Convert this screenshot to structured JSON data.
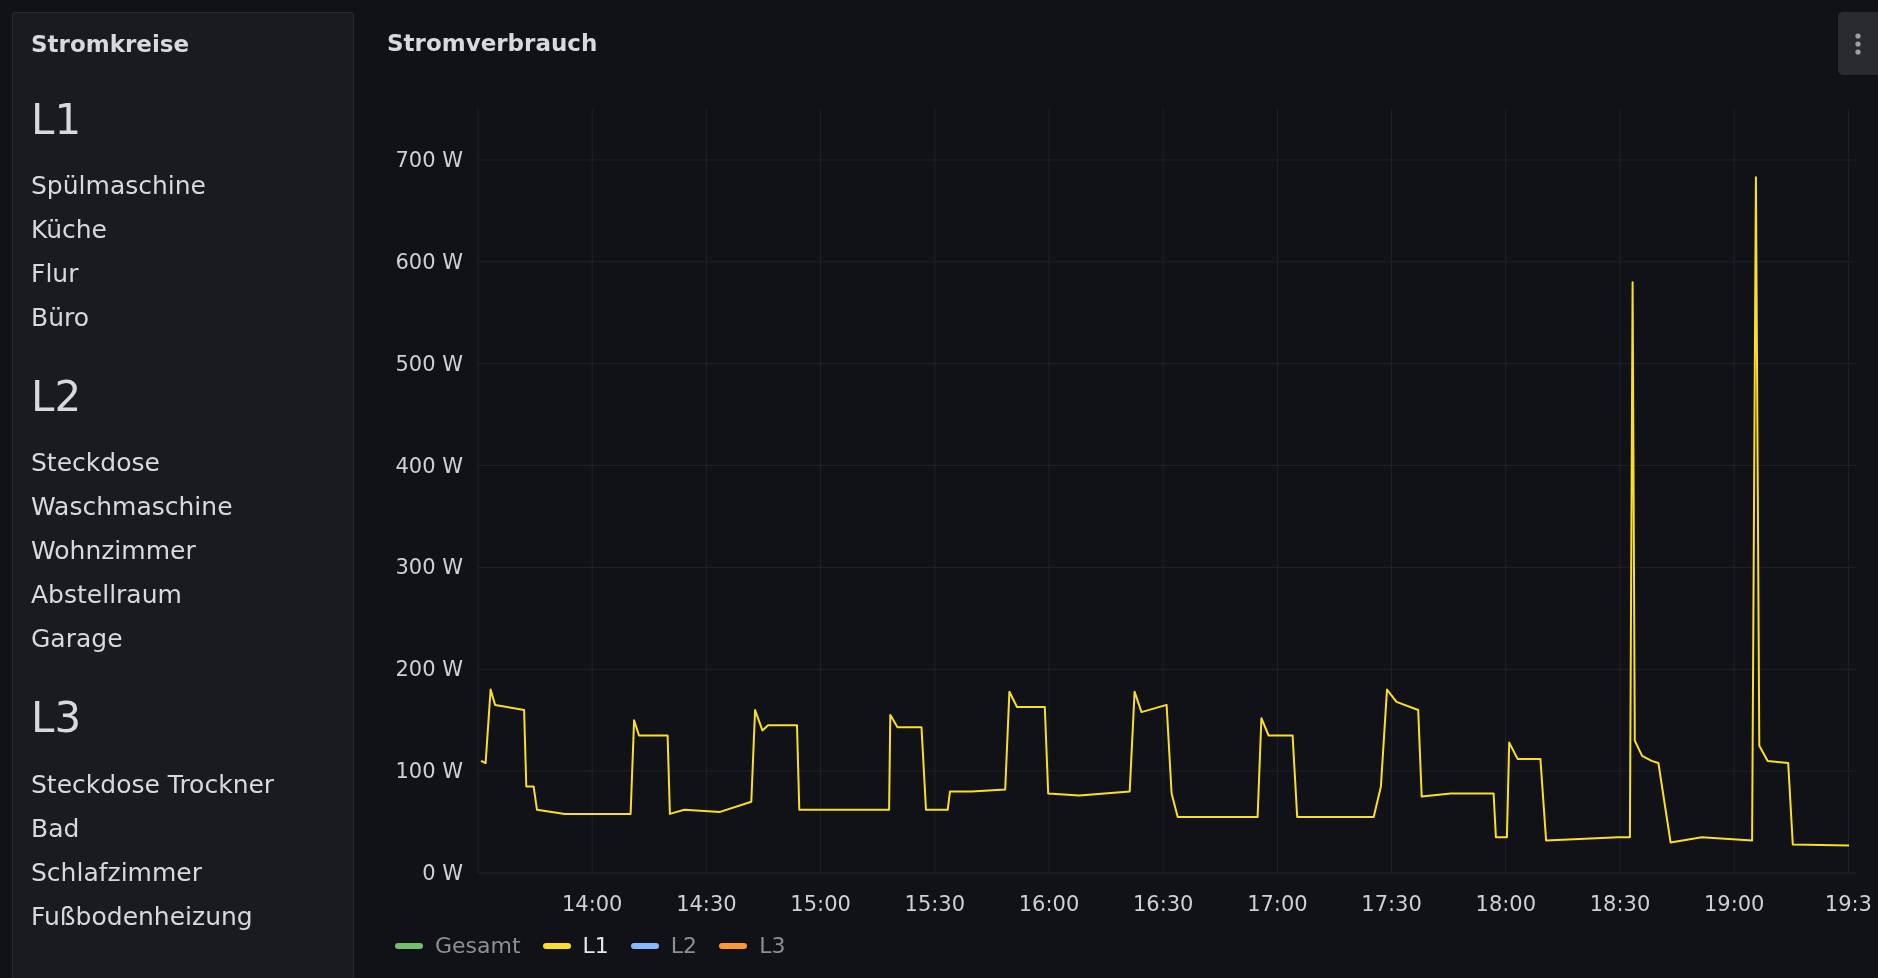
{
  "circuits_panel": {
    "title": "Stromkreise",
    "sections": [
      {
        "heading": "L1",
        "items": [
          "Spülmaschine",
          "Küche",
          "Flur",
          "Büro"
        ]
      },
      {
        "heading": "L2",
        "items": [
          "Steckdose",
          "Waschmaschine",
          "Wohnzimmer",
          "Abstellraum",
          "Garage"
        ]
      },
      {
        "heading": "L3",
        "items": [
          "Steckdose Trockner",
          "Bad",
          "Schlafzimmer",
          "Fußbodenheizung"
        ]
      }
    ]
  },
  "consumption_panel": {
    "title": "Stromverbrauch",
    "chart_data": {
      "type": "line",
      "grid": true,
      "x": [
        810.8,
        812.0,
        813.3,
        814.5,
        822.1,
        822.7,
        824.6,
        825.5,
        832.8,
        841.3,
        850.1,
        851.0,
        852.3,
        859.8,
        860.4,
        864.2,
        873.6,
        881.8,
        882.8,
        884.7,
        886.2,
        893.8,
        894.4,
        905.1,
        918.0,
        918.3,
        920.2,
        926.5,
        927.7,
        933.4,
        934.0,
        939.7,
        948.5,
        949.6,
        951.6,
        958.9,
        959.8,
        968.0,
        981.2,
        982.5,
        984.3,
        990.9,
        992.2,
        993.8,
        999.4,
        1014.8,
        1015.8,
        1017.7,
        1024.0,
        1025.2,
        1045.3,
        1047.2,
        1048.8,
        1051.3,
        1057.0,
        1057.9,
        1065.5,
        1076.8,
        1077.4,
        1080.3,
        1080.9,
        1083.1,
        1089.1,
        1090.6,
        1109.5,
        1112.6,
        1113.3,
        1113.9,
        1115.8,
        1118.3,
        1120.1,
        1123.3,
        1131.5,
        1144.7,
        1145.7,
        1146.6,
        1148.8,
        1154.2,
        1155.4,
        1170.2
      ],
      "series": [
        {
          "name": "L1",
          "color": "#fade2a",
          "values": [
            110,
            108,
            180,
            165,
            160,
            85,
            85,
            62,
            58,
            58,
            58,
            150,
            135,
            135,
            58,
            62,
            60,
            70,
            160,
            140,
            145,
            145,
            62,
            62,
            62,
            155,
            143,
            143,
            62,
            62,
            80,
            80,
            82,
            178,
            163,
            163,
            78,
            76,
            80,
            178,
            158,
            165,
            78,
            55,
            55,
            55,
            152,
            135,
            135,
            55,
            55,
            85,
            180,
            168,
            160,
            75,
            78,
            78,
            35,
            35,
            128,
            112,
            112,
            32,
            35,
            35,
            580,
            130,
            115,
            110,
            108,
            30,
            35,
            32,
            683,
            125,
            110,
            108,
            28,
            27
          ]
        }
      ],
      "xlim": [
        810,
        1172
      ],
      "ylim": [
        0,
        750
      ],
      "xticks": [
        {
          "value": 840,
          "label": "14:00"
        },
        {
          "value": 870,
          "label": "14:30"
        },
        {
          "value": 900,
          "label": "15:00"
        },
        {
          "value": 930,
          "label": "15:30"
        },
        {
          "value": 960,
          "label": "16:00"
        },
        {
          "value": 990,
          "label": "16:30"
        },
        {
          "value": 1020,
          "label": "17:00"
        },
        {
          "value": 1050,
          "label": "17:30"
        },
        {
          "value": 1080,
          "label": "18:00"
        },
        {
          "value": 1110,
          "label": "18:30"
        },
        {
          "value": 1140,
          "label": "19:00"
        },
        {
          "value": 1170,
          "label": "19:3"
        }
      ],
      "yticks": [
        {
          "value": 0,
          "label": "0 W"
        },
        {
          "value": 100,
          "label": "100 W"
        },
        {
          "value": 200,
          "label": "200 W"
        },
        {
          "value": 300,
          "label": "300 W"
        },
        {
          "value": 400,
          "label": "400 W"
        },
        {
          "value": 500,
          "label": "500 W"
        },
        {
          "value": 600,
          "label": "600 W"
        },
        {
          "value": 700,
          "label": "700 W"
        }
      ]
    },
    "legend": [
      {
        "kind": "hidden",
        "label": "Gesamt",
        "color": "#73bf69",
        "visible": false
      },
      {
        "kind": "plotted",
        "visible": true
      },
      {
        "kind": "hidden",
        "label": "L2",
        "color": "#8ab8ff",
        "visible": false
      },
      {
        "kind": "hidden",
        "label": "L3",
        "color": "#ff9830",
        "visible": false
      }
    ]
  }
}
